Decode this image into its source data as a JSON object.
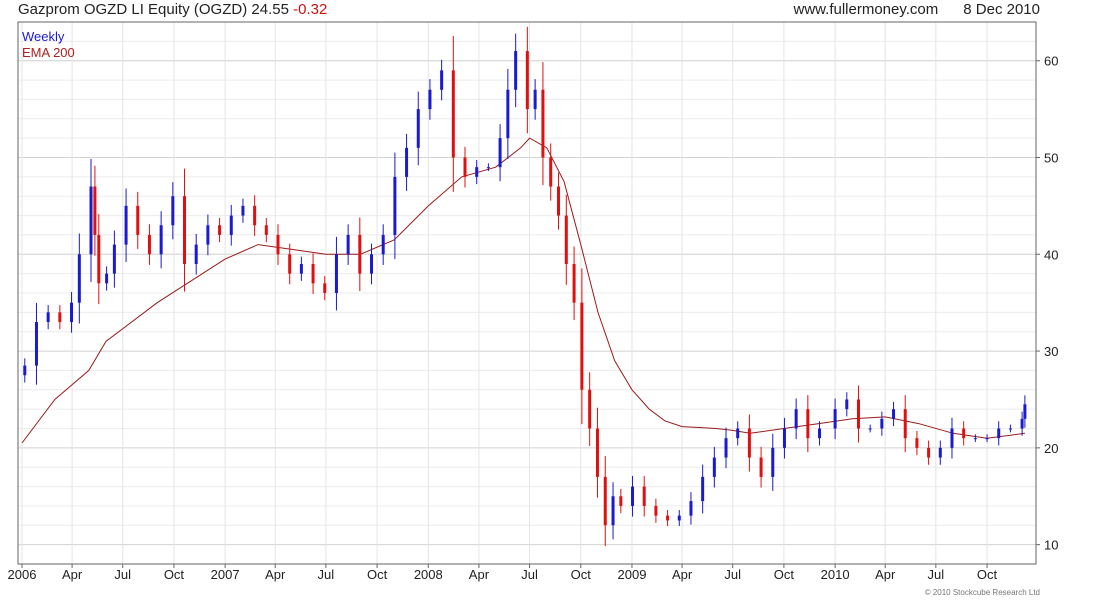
{
  "header": {
    "title": "Gazprom OGZD LI Equity (OGZD)",
    "price": "24.55",
    "change": "-0.32",
    "source": "www.fullermoney.com",
    "date": "8 Dec 2010"
  },
  "footer": {
    "copyright": "© 2010 Stockcube Research Ltd"
  },
  "colors": {
    "up_candle": "#1a1ad0",
    "down_candle": "#e01010",
    "ema_line": "#9a1a1a",
    "grid": "#d4d4d4",
    "frame": "#666666"
  },
  "chart_data": {
    "type": "line",
    "title": "Gazprom OGZD LI Equity (OGZD)",
    "xlabel": "",
    "ylabel": "",
    "ylim": [
      8,
      64
    ],
    "yticks": [
      10,
      20,
      30,
      40,
      50,
      60
    ],
    "xlim": [
      "2006-01-01",
      "2010-12-10"
    ],
    "xticks": [
      {
        "date": "2006-01-01",
        "label": "2006"
      },
      {
        "date": "2006-04-01",
        "label": "Apr"
      },
      {
        "date": "2006-07-01",
        "label": "Jul"
      },
      {
        "date": "2006-10-01",
        "label": "Oct"
      },
      {
        "date": "2007-01-01",
        "label": "2007"
      },
      {
        "date": "2007-04-01",
        "label": "Apr"
      },
      {
        "date": "2007-07-01",
        "label": "Jul"
      },
      {
        "date": "2007-10-01",
        "label": "Oct"
      },
      {
        "date": "2008-01-01",
        "label": "2008"
      },
      {
        "date": "2008-04-01",
        "label": "Apr"
      },
      {
        "date": "2008-07-01",
        "label": "Jul"
      },
      {
        "date": "2008-10-01",
        "label": "Oct"
      },
      {
        "date": "2009-01-01",
        "label": "2009"
      },
      {
        "date": "2009-04-01",
        "label": "Apr"
      },
      {
        "date": "2009-07-01",
        "label": "Jul"
      },
      {
        "date": "2009-10-01",
        "label": "Oct"
      },
      {
        "date": "2010-01-01",
        "label": "2010"
      },
      {
        "date": "2010-04-01",
        "label": "Apr"
      },
      {
        "date": "2010-07-01",
        "label": "Jul"
      },
      {
        "date": "2010-10-01",
        "label": "Oct"
      }
    ],
    "grid": true,
    "legend_position": "top-left",
    "series": [
      {
        "name": "Weekly",
        "type": "candlestick-closes",
        "x": [
          "2006-01-06",
          "2006-01-27",
          "2006-02-17",
          "2006-03-10",
          "2006-03-31",
          "2006-04-14",
          "2006-05-05",
          "2006-05-12",
          "2006-05-19",
          "2006-06-02",
          "2006-06-16",
          "2006-07-07",
          "2006-07-28",
          "2006-08-18",
          "2006-09-08",
          "2006-09-29",
          "2006-10-20",
          "2006-11-10",
          "2006-12-01",
          "2006-12-22",
          "2007-01-12",
          "2007-02-02",
          "2007-02-23",
          "2007-03-16",
          "2007-04-06",
          "2007-04-27",
          "2007-05-18",
          "2007-06-08",
          "2007-06-29",
          "2007-07-20",
          "2007-08-10",
          "2007-08-31",
          "2007-09-21",
          "2007-10-12",
          "2007-11-02",
          "2007-11-23",
          "2007-12-14",
          "2008-01-04",
          "2008-01-25",
          "2008-02-15",
          "2008-03-07",
          "2008-03-28",
          "2008-04-18",
          "2008-05-09",
          "2008-05-23",
          "2008-06-06",
          "2008-06-27",
          "2008-07-11",
          "2008-07-25",
          "2008-08-08",
          "2008-08-22",
          "2008-09-05",
          "2008-09-19",
          "2008-10-03",
          "2008-10-17",
          "2008-10-31",
          "2008-11-14",
          "2008-11-28",
          "2008-12-12",
          "2009-01-02",
          "2009-01-23",
          "2009-02-13",
          "2009-03-06",
          "2009-03-27",
          "2009-04-17",
          "2009-05-08",
          "2009-05-29",
          "2009-06-19",
          "2009-07-10",
          "2009-07-31",
          "2009-08-21",
          "2009-09-11",
          "2009-10-02",
          "2009-10-23",
          "2009-11-13",
          "2009-12-04",
          "2010-01-01",
          "2010-01-22",
          "2010-02-12",
          "2010-03-05",
          "2010-03-26",
          "2010-04-16",
          "2010-05-07",
          "2010-05-28",
          "2010-06-18",
          "2010-07-09",
          "2010-07-30",
          "2010-08-20",
          "2010-09-10",
          "2010-10-01",
          "2010-10-22",
          "2010-11-12",
          "2010-12-03",
          "2010-12-08"
        ],
        "values": [
          28.5,
          33,
          34,
          33,
          35,
          40,
          47,
          42,
          37,
          38,
          41,
          45,
          42,
          40,
          43,
          46,
          39,
          41,
          43,
          42,
          44,
          45,
          43,
          42,
          40,
          38,
          39,
          37,
          36,
          40,
          42,
          38,
          40,
          42,
          48,
          51,
          55,
          57,
          59,
          50,
          48,
          49,
          49,
          52,
          57,
          61,
          55,
          57,
          50,
          47,
          44,
          39,
          35,
          26,
          22,
          17,
          12,
          15,
          14,
          16,
          14,
          13,
          12.5,
          13,
          14.5,
          17,
          19,
          21,
          22,
          19,
          17,
          20,
          22,
          24,
          21,
          22,
          24,
          25,
          22,
          22,
          23,
          24,
          21,
          20,
          19,
          20,
          22,
          21,
          21,
          21,
          22,
          22,
          23,
          24.5
        ]
      },
      {
        "name": "EMA 200",
        "type": "line",
        "x": [
          "2006-01-01",
          "2006-03-01",
          "2006-05-01",
          "2006-06-01",
          "2006-09-01",
          "2007-01-01",
          "2007-03-01",
          "2007-05-01",
          "2007-07-01",
          "2007-09-01",
          "2007-11-01",
          "2008-01-01",
          "2008-03-01",
          "2008-05-01",
          "2008-06-15",
          "2008-07-01",
          "2008-08-01",
          "2008-09-01",
          "2008-10-01",
          "2008-11-01",
          "2008-12-01",
          "2009-01-01",
          "2009-02-01",
          "2009-03-01",
          "2009-04-01",
          "2009-05-01",
          "2009-06-01",
          "2009-07-01",
          "2009-08-01",
          "2009-10-01",
          "2009-12-01",
          "2010-02-01",
          "2010-04-01",
          "2010-06-01",
          "2010-08-01",
          "2010-10-01",
          "2010-12-08"
        ],
        "values": [
          20.5,
          25,
          28,
          31,
          35,
          39.5,
          41,
          40.5,
          40,
          40,
          41.5,
          45,
          48,
          49,
          51,
          52,
          51,
          47.5,
          41,
          34,
          29,
          26,
          24,
          22.8,
          22.2,
          22.1,
          22.0,
          21.8,
          21.5,
          22.0,
          22.5,
          23.0,
          23.2,
          22.5,
          21.5,
          21.0,
          21.5
        ]
      }
    ]
  }
}
